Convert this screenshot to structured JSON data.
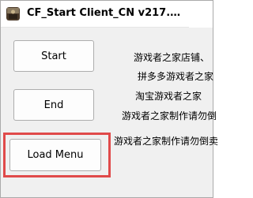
{
  "window": {
    "title": "CF_Start Client_CN v217.…",
    "accent_color": "#e04a4a"
  },
  "buttons": {
    "start_label": "Start",
    "end_label": "End",
    "load_menu_label": "Load Menu"
  },
  "info_lines": [
    "游戏者之家店铺、",
    "拼多多游戏者之家",
    "淘宝游戏者之家",
    "游戏者之家制作请勿倒",
    "游戏者之家制作请勿倒卖"
  ]
}
